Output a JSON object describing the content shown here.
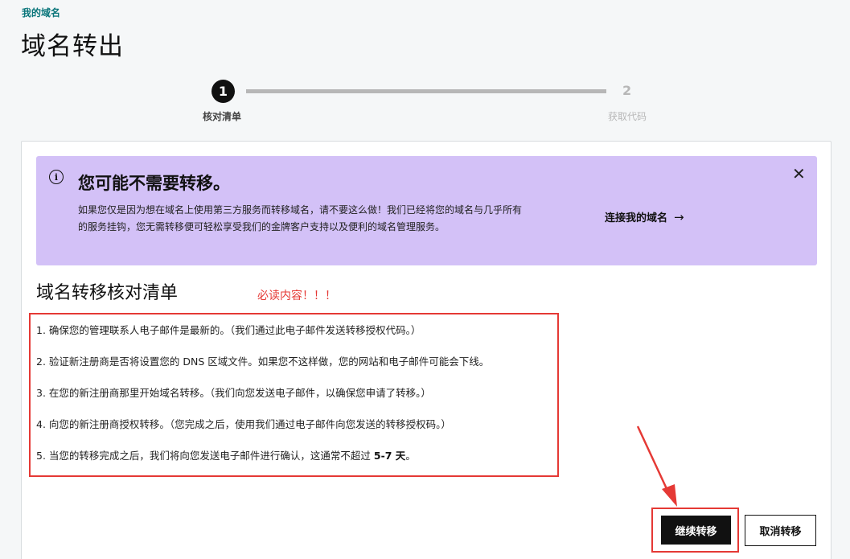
{
  "breadcrumb": "我的域名",
  "page_title": "域名转出",
  "stepper": {
    "step1_number": "1",
    "step1_label": "核对清单",
    "step2_number": "2",
    "step2_label": "获取代码"
  },
  "banner": {
    "info_glyph": "i",
    "title": "您可能不需要转移。",
    "body": "如果您仅是因为想在域名上使用第三方服务而转移域名，请不要这么做！我们已经将您的域名与几乎所有的服务挂钩，您无需转移便可轻松享受我们的金牌客户支持以及便利的域名管理服务。",
    "link_label": "连接我的域名",
    "link_arrow": "→",
    "close_glyph": "✕",
    "background_color": "#d3c1f7"
  },
  "checklist": {
    "title": "域名转移核对清单",
    "annotation": "必读内容！！！",
    "items": [
      "1. 确保您的管理联系人电子邮件是最新的。（我们通过此电子邮件发送转移授权代码。）",
      "2. 验证新注册商是否将设置您的 DNS 区域文件。如果您不这样做，您的网站和电子邮件可能会下线。",
      "3. 在您的新注册商那里开始域名转移。（我们向您发送电子邮件，以确保您申请了转移。）",
      "4. 向您的新注册商授权转移。（您完成之后，使用我们通过电子邮件向您发送的转移授权码。）"
    ],
    "item5_prefix": "5. 当您的转移完成之后，我们将向您发送电子邮件进行确认，这通常不超过 ",
    "item5_bold": "5-7 天",
    "item5_suffix": "。"
  },
  "actions": {
    "continue_label": "继续转移",
    "cancel_label": "取消转移"
  },
  "colors": {
    "accent_teal": "#09757a",
    "annotation_red": "#e53935",
    "primary_button": "#111111"
  }
}
